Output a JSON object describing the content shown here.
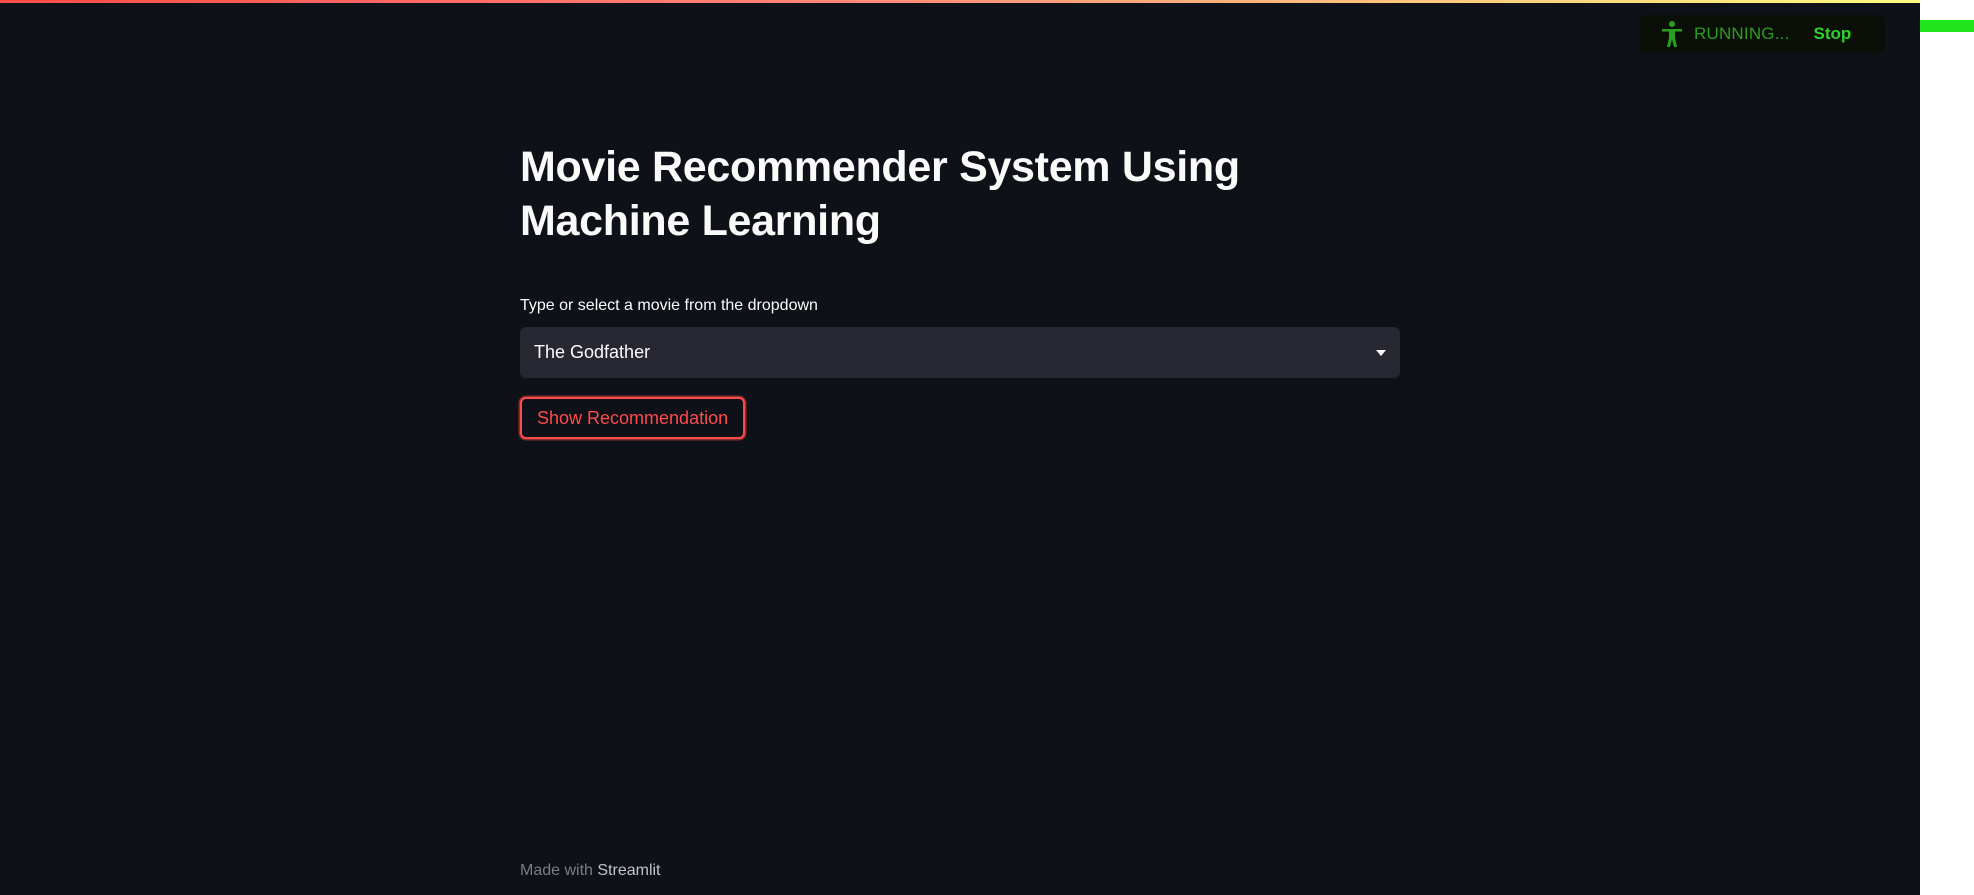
{
  "header": {
    "status_text": "RUNNING...",
    "stop_label": "Stop",
    "running_icon": "running-person-icon",
    "menu_icon": "hamburger-menu-icon"
  },
  "main": {
    "title": "Movie Recommender System Using Machine Learning",
    "select_label": "Type or select a movie from the dropdown",
    "selected_movie": "The Godfather",
    "button_label": "Show Recommendation"
  },
  "footer": {
    "made_with": "Made with",
    "brand": "Streamlit"
  },
  "colors": {
    "background": "#0e1117",
    "accent": "#ff4b4b",
    "running_green": "#2ed12a",
    "select_bg": "#262730"
  }
}
